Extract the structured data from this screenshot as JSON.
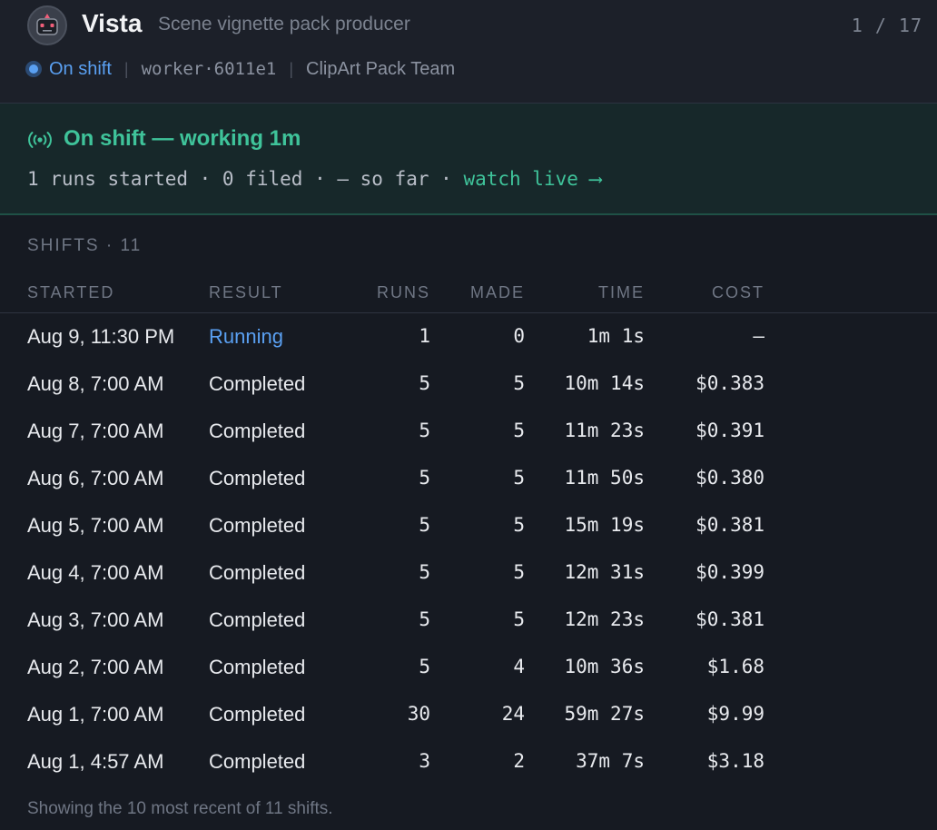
{
  "header": {
    "title": "Vista",
    "subtitle": "Scene vignette pack producer",
    "pager": "1 / 17",
    "status": "On shift",
    "worker_id": "worker·6011e1",
    "team": "ClipArt Pack Team"
  },
  "banner": {
    "title": "On shift — working 1m",
    "summary": "1 runs started · 0 filed · — so far · ",
    "watch_link": "watch live ⟶",
    "accent_color": "#3fc39a"
  },
  "shifts": {
    "section_label": "SHIFTS · 11",
    "columns": {
      "started": "STARTED",
      "result": "RESULT",
      "runs": "RUNS",
      "made": "MADE",
      "time": "TIME",
      "cost": "COST"
    },
    "rows": [
      {
        "started": "Aug 9, 11:30 PM",
        "result": "Running",
        "runs": "1",
        "made": "0",
        "time": "1m 1s",
        "cost": "—"
      },
      {
        "started": "Aug 8, 7:00 AM",
        "result": "Completed",
        "runs": "5",
        "made": "5",
        "time": "10m 14s",
        "cost": "$0.383"
      },
      {
        "started": "Aug 7, 7:00 AM",
        "result": "Completed",
        "runs": "5",
        "made": "5",
        "time": "11m 23s",
        "cost": "$0.391"
      },
      {
        "started": "Aug 6, 7:00 AM",
        "result": "Completed",
        "runs": "5",
        "made": "5",
        "time": "11m 50s",
        "cost": "$0.380"
      },
      {
        "started": "Aug 5, 7:00 AM",
        "result": "Completed",
        "runs": "5",
        "made": "5",
        "time": "15m 19s",
        "cost": "$0.381"
      },
      {
        "started": "Aug 4, 7:00 AM",
        "result": "Completed",
        "runs": "5",
        "made": "5",
        "time": "12m 31s",
        "cost": "$0.399"
      },
      {
        "started": "Aug 3, 7:00 AM",
        "result": "Completed",
        "runs": "5",
        "made": "5",
        "time": "12m 23s",
        "cost": "$0.381"
      },
      {
        "started": "Aug 2, 7:00 AM",
        "result": "Completed",
        "runs": "5",
        "made": "4",
        "time": "10m 36s",
        "cost": "$1.68"
      },
      {
        "started": "Aug 1, 7:00 AM",
        "result": "Completed",
        "runs": "30",
        "made": "24",
        "time": "59m 27s",
        "cost": "$9.99"
      },
      {
        "started": "Aug 1, 4:57 AM",
        "result": "Completed",
        "runs": "3",
        "made": "2",
        "time": "37m 7s",
        "cost": "$3.18"
      }
    ],
    "footer_note": "Showing the 10 most recent of 11 shifts."
  }
}
